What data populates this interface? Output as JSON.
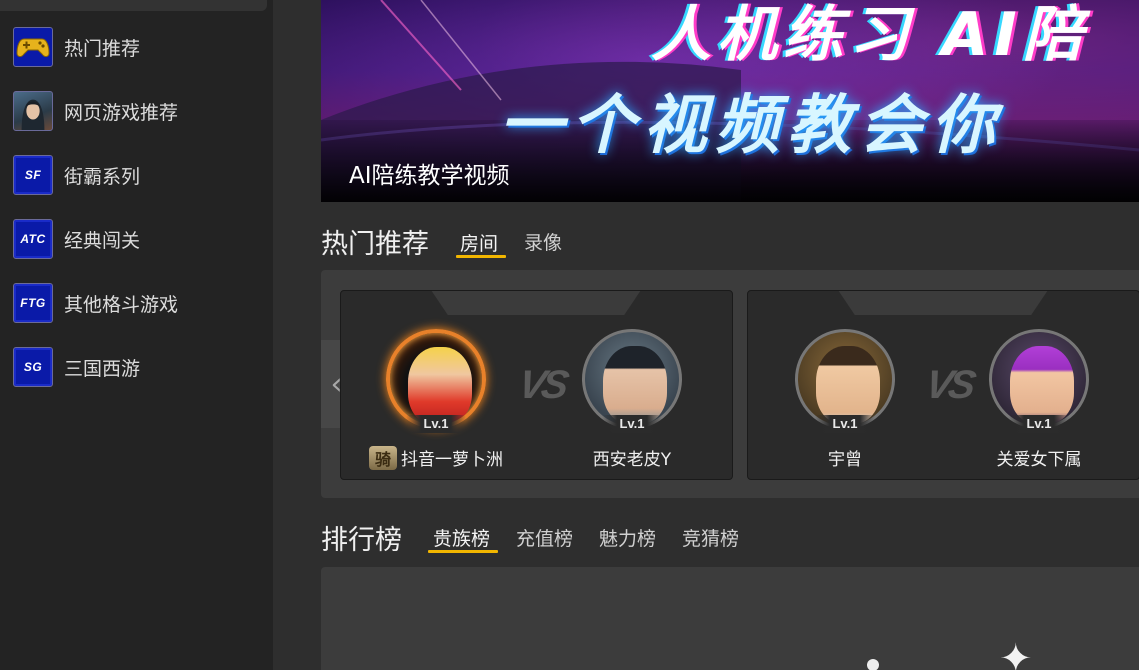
{
  "sidebar": {
    "items": [
      {
        "label": "热门推荐",
        "icon": "gamepad-icon",
        "badge": ""
      },
      {
        "label": "网页游戏推荐",
        "icon": "game-avatar-icon",
        "badge": ""
      },
      {
        "label": "街霸系列",
        "icon": "sf-badge-icon",
        "badge": "SF"
      },
      {
        "label": "经典闯关",
        "icon": "atc-badge-icon",
        "badge": "ATC"
      },
      {
        "label": "其他格斗游戏",
        "icon": "ftg-badge-icon",
        "badge": "FTG"
      },
      {
        "label": "三国西游",
        "icon": "sg-badge-icon",
        "badge": "SG"
      }
    ]
  },
  "banner": {
    "caption": "AI陪练教学视频",
    "line1": "人机练习 AI陪",
    "line2": "一个视频教会你"
  },
  "hot": {
    "title": "热门推荐",
    "tabs": [
      {
        "label": "房间",
        "active": true
      },
      {
        "label": "录像",
        "active": false
      }
    ],
    "rooms": [
      {
        "players": [
          {
            "name": "抖音一萝卜洲",
            "level": "Lv.1",
            "rank_icon": "骑",
            "avatar": "fire-frame-avatar"
          },
          {
            "name": "西安老皮Y",
            "level": "Lv.1",
            "rank_icon": "",
            "avatar": "fighter-avatar"
          }
        ]
      },
      {
        "players": [
          {
            "name": "宇曾",
            "level": "Lv.1",
            "rank_icon": "",
            "avatar": "smiling-man-avatar"
          },
          {
            "name": "关爱女下属",
            "level": "Lv.1",
            "rank_icon": "",
            "avatar": "purple-hair-avatar"
          }
        ]
      }
    ]
  },
  "ranking": {
    "title": "排行榜",
    "tabs": [
      {
        "label": "贵族榜",
        "active": true
      },
      {
        "label": "充值榜",
        "active": false
      },
      {
        "label": "魅力榜",
        "active": false
      },
      {
        "label": "竞猜榜",
        "active": false
      }
    ]
  },
  "colors": {
    "accent": "#f2b600",
    "sidebar_bg": "#232323",
    "main_bg": "#2e2e2e",
    "panel_bg": "#3c3c3c",
    "badge_blue": "#0a1aa8"
  }
}
